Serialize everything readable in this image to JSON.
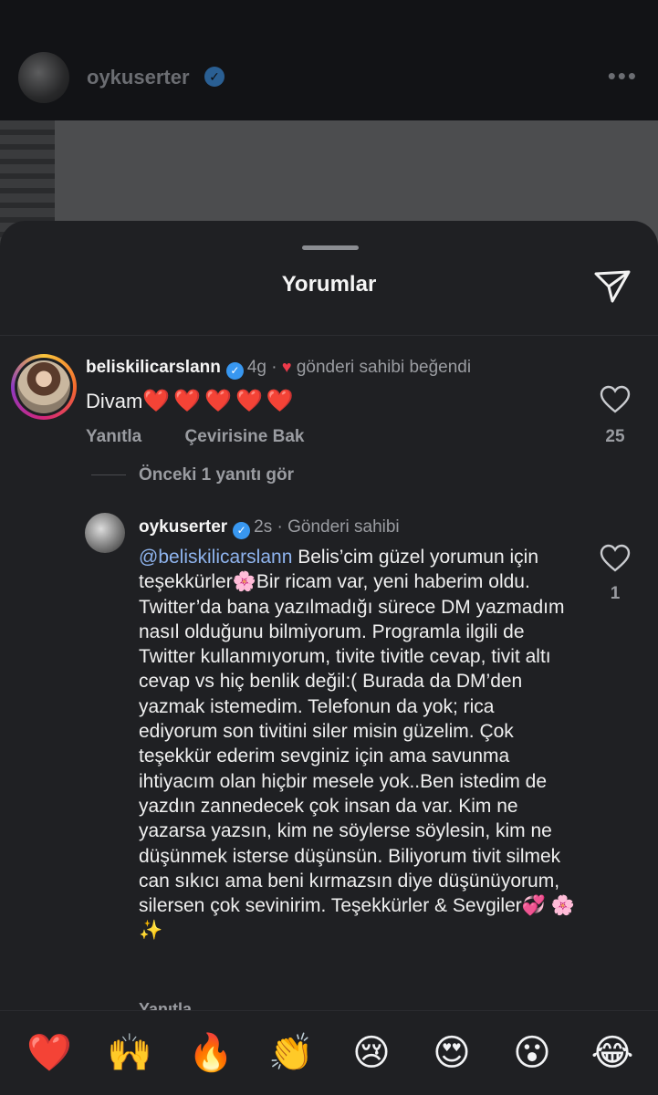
{
  "post_header": {
    "username": "oykuserter",
    "more_icon": "more-horizontal-icon"
  },
  "sheet": {
    "title": "Yorumlar",
    "share_icon": "send-icon"
  },
  "comment": {
    "username": "beliskilicarslann",
    "time": "4g",
    "separator": "·",
    "liked_by_author": "gönderi sahibi beğendi",
    "text": "Divam",
    "hearts": "❤️❤️❤️❤️❤️",
    "reply_label": "Yanıtla",
    "translate_label": "Çevirisine Bak",
    "like_count": "25",
    "view_replies": "Önceki 1 yanıtı gör"
  },
  "reply": {
    "username": "oykuserter",
    "time": "2s",
    "separator": "·",
    "role": "Gönderi sahibi",
    "mention": "@beliskilicarslann",
    "text": "Belis’cim güzel yorumun için teşekkürler🌸Bir ricam var, yeni haberim oldu. Twitter’da bana yazılmadığı sürece DM yazmadım nasıl olduğunu bilmiyorum. Programla ilgili de Twitter kullanmıyorum, tivite tivitle cevap, tivit altı cevap vs hiç benlik değil:( Burada da DM’den yazmak istemedim. Telefonun da yok; rica ediyorum son tivitini siler misin güzelim. Çok teşekkür ederim sevginiz için ama savunma ihtiyacım olan hiçbir mesele yok..Ben istedim de yazdın zannedecek çok insan da var. Kim ne yazarsa yazsın, kim ne söylerse söylesin, kim ne düşünmek isterse düşünsün. Biliyorum tivit silmek can sıkıcı ama beni kırmazsın diye düşünüyorum, silersen çok sevinirim. Teşekkürler & Sevgiler💞 🌸 ✨",
    "like_count": "1",
    "reply_label": "Yanıtla"
  },
  "emoji_bar": [
    "❤️",
    "🙌",
    "🔥",
    "👏",
    "😢",
    "😍",
    "😮",
    "😂"
  ]
}
